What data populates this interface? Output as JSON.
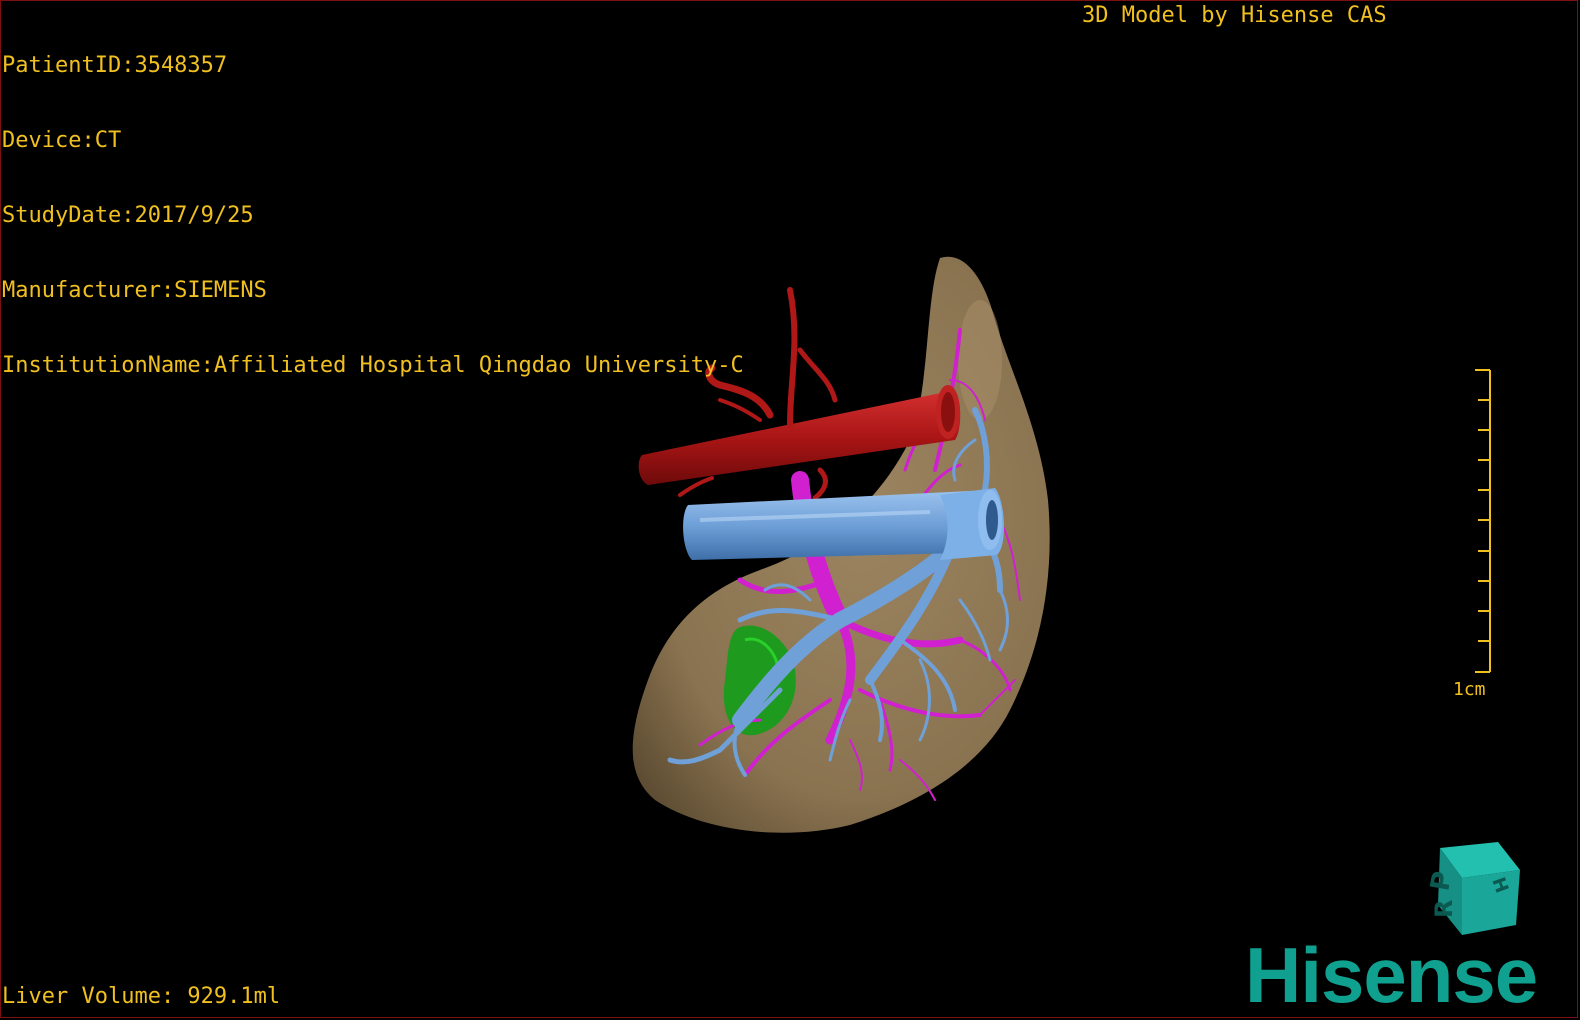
{
  "overlay": {
    "patient_id": "PatientID:3548357",
    "device": "Device:CT",
    "study_date": "StudyDate:2017/9/25",
    "manufacturer": "Manufacturer:SIEMENS",
    "institution": "InstitutionName:Affiliated Hospital Qingdao University-C",
    "credit": "3D Model by Hisense CAS",
    "liver_volume": "Liver Volume: 929.1ml",
    "scale_label": "1cm"
  },
  "brand": {
    "name": "Hisense"
  },
  "orientation_cube": {
    "letters": [
      "P",
      "H",
      "R"
    ],
    "color": "#1aa79a"
  },
  "colors": {
    "text": "#f0c020",
    "liver": "#8a7350",
    "artery": "#b01818",
    "vein": "#6fa0d8",
    "portal": "#d020d0",
    "lesion": "#20a020",
    "brand": "#10a090"
  }
}
